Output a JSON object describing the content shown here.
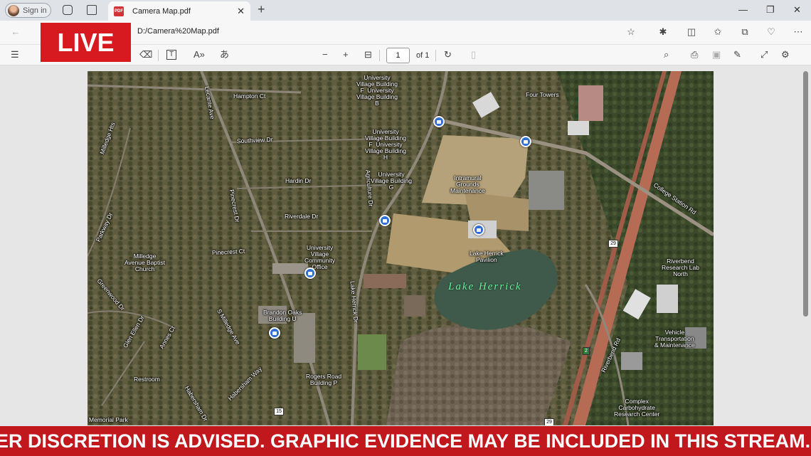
{
  "browser": {
    "signin_label": "Sign in",
    "tab_title": "Camera Map.pdf",
    "url": "D:/Camera%20Map.pdf"
  },
  "pdf_toolbar": {
    "page_value": "1",
    "page_total": "of 1"
  },
  "live_badge": "LIVE",
  "map": {
    "streets": [
      {
        "text": "Hampton Ct"
      },
      {
        "text": "Lecante Ave"
      },
      {
        "text": "Southview Dr"
      },
      {
        "text": "Milledge Hts"
      },
      {
        "text": "Hardin Dr"
      },
      {
        "text": "Pinecrest Dr"
      },
      {
        "text": "Riverdale Dr"
      },
      {
        "text": "Pinecrest Ct"
      },
      {
        "text": "Parkway Dr"
      },
      {
        "text": "Greenwood Dr"
      },
      {
        "text": "Glen Ellen Dr"
      },
      {
        "text": "Annes Ct"
      },
      {
        "text": "S Milledge Ave"
      },
      {
        "text": "Habersham Way"
      },
      {
        "text": "Habersham Dr"
      },
      {
        "text": "Agriculture Dr"
      },
      {
        "text": "Lake Herrick Dr"
      },
      {
        "text": "College Station Rd"
      },
      {
        "text": "Riverbend Rd"
      },
      {
        "text": "Memorial Park"
      },
      {
        "text": "Restroom"
      }
    ],
    "places": [
      {
        "text": "University\nVillage Building\nF  University\nVillage Building\nB"
      },
      {
        "text": "University\nVillage Building\nF  University\nVillage Building\nH"
      },
      {
        "text": "University\nVillage Building\nG"
      },
      {
        "text": "Four Towers"
      },
      {
        "text": "Intramural\nGrounds\nMaintenance"
      },
      {
        "text": "Lake Herrick\nPavilion"
      },
      {
        "text": "University\nVillage\nCommunity\nOffice"
      },
      {
        "text": "Milledge\nAvenue Baptist\nChurch"
      },
      {
        "text": "Brandon Oaks\nBuilding U"
      },
      {
        "text": "Rogers Road\nBuilding P"
      },
      {
        "text": "Riverbend\nResearch Lab\nNorth"
      },
      {
        "text": "Vehicle\nTransportation\n& Maintenance"
      },
      {
        "text": "Complex\nCarbohydrate\nResearch Center"
      }
    ],
    "lake_label": "Lake Herrick",
    "route_shields": [
      "29",
      "15",
      "29",
      "2"
    ]
  },
  "ticker_text": "ER DISCRETION IS ADVISED.  GRAPHIC EVIDENCE MAY BE INCLUDED IN THIS STREAM.",
  "colors": {
    "live_red": "#d71920",
    "ticker_red": "#c0181d",
    "camera_blue": "#2f6fd6",
    "lake_label": "#6df0a3"
  }
}
